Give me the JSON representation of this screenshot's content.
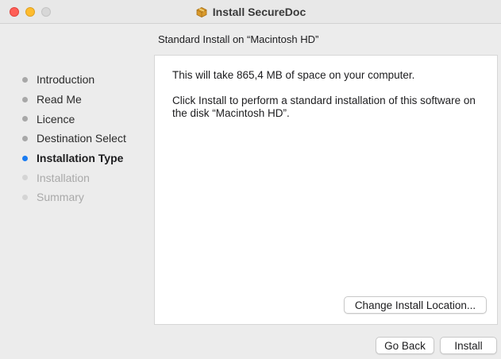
{
  "window": {
    "title": "Install SecureDoc",
    "title_icon": "package-icon"
  },
  "header": {
    "subtitle": "Standard Install on “Macintosh HD”"
  },
  "sidebar": {
    "items": [
      {
        "label": "Introduction",
        "state": "done"
      },
      {
        "label": "Read Me",
        "state": "done"
      },
      {
        "label": "Licence",
        "state": "done"
      },
      {
        "label": "Destination Select",
        "state": "done"
      },
      {
        "label": "Installation Type",
        "state": "current"
      },
      {
        "label": "Installation",
        "state": "future"
      },
      {
        "label": "Summary",
        "state": "future"
      }
    ]
  },
  "content": {
    "space_text": "This will take 865,4 MB of space on your computer.",
    "instruction_text": "Click Install to perform a standard installation of this software on the disk “Macintosh HD”.",
    "change_location_label": "Change Install Location..."
  },
  "footer": {
    "go_back_label": "Go Back",
    "install_label": "Install"
  },
  "colors": {
    "accent": "#1a7cf2",
    "close": "#ff5f57",
    "minimize": "#febc2e",
    "maximize_disabled": "#d7d7d7"
  }
}
